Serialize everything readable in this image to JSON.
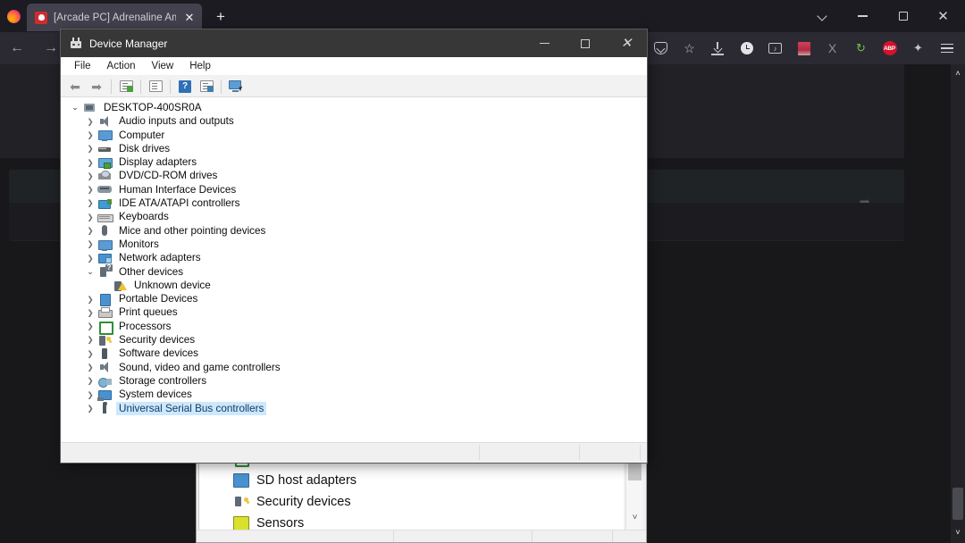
{
  "browser": {
    "name": "firefox",
    "logo_icon": "firefox-logo-icon",
    "tab": {
      "title": "[Arcade PC] Adrenaline Amusem",
      "favicon_icon": "site-favicon-icon",
      "close_icon": "✕"
    },
    "new_tab_label": "+",
    "list_all_tabs_icon": "chevron-down-icon",
    "window_controls": {
      "minimize": "—",
      "maximize": "❐",
      "close": "✕"
    },
    "nav": {
      "back_icon": "←",
      "forward_icon": "→"
    },
    "toolbar_icons": [
      {
        "name": "pocket-icon",
        "label": ""
      },
      {
        "name": "bookmark-star-icon",
        "label": "☆"
      },
      {
        "name": "downloads-icon",
        "label": ""
      },
      {
        "name": "history-clock-icon",
        "label": ""
      },
      {
        "name": "screenshot-icon",
        "label": "♪"
      },
      {
        "name": "extension-red-icon",
        "label": ""
      },
      {
        "name": "x-extension-icon",
        "label": "X"
      },
      {
        "name": "translate-sync-icon",
        "label": "↻"
      },
      {
        "name": "adblock-plus-icon",
        "label": "ABP"
      },
      {
        "name": "extensions-puzzle-icon",
        "label": "✦"
      },
      {
        "name": "app-menu-icon",
        "label": ""
      }
    ],
    "scrollbar": {
      "up_icon": "˄",
      "down_icon": "˅"
    }
  },
  "device_manager": {
    "title": "Device Manager",
    "title_icon": "device-manager-icon",
    "window_controls": {
      "minimize": "—",
      "maximize": "□",
      "close": "✕"
    },
    "menus": [
      {
        "label": "File"
      },
      {
        "label": "Action"
      },
      {
        "label": "View"
      },
      {
        "label": "Help"
      }
    ],
    "toolbar": [
      {
        "name": "back-button",
        "icon": "⬅"
      },
      {
        "name": "forward-button",
        "icon": "➡"
      },
      {
        "name": "properties-button",
        "icon": "properties-icon"
      },
      {
        "name": "update-driver-button",
        "icon": "update-driver-icon"
      },
      {
        "name": "help-button",
        "icon": "?"
      },
      {
        "name": "scan-hardware-button",
        "icon": "scan-icon"
      },
      {
        "name": "show-hidden-devices-button",
        "icon": "monitor-icon"
      }
    ],
    "tree": [
      {
        "label": "DESKTOP-400SR0A",
        "level": 0,
        "twist": "open",
        "icon": "ic-pc",
        "selected": false
      },
      {
        "label": "Audio inputs and outputs",
        "level": 1,
        "twist": "closed",
        "icon": "ic-speaker",
        "selected": false
      },
      {
        "label": "Computer",
        "level": 1,
        "twist": "closed",
        "icon": "ic-monitor2",
        "selected": false
      },
      {
        "label": "Disk drives",
        "level": 1,
        "twist": "closed",
        "icon": "ic-disk",
        "selected": false
      },
      {
        "label": "Display adapters",
        "level": 1,
        "twist": "closed",
        "icon": "ic-display",
        "selected": false
      },
      {
        "label": "DVD/CD-ROM drives",
        "level": 1,
        "twist": "closed",
        "icon": "ic-dvd",
        "selected": false
      },
      {
        "label": "Human Interface Devices",
        "level": 1,
        "twist": "closed",
        "icon": "ic-hid",
        "selected": false
      },
      {
        "label": "IDE ATA/ATAPI controllers",
        "level": 1,
        "twist": "closed",
        "icon": "ic-ide",
        "selected": false
      },
      {
        "label": "Keyboards",
        "level": 1,
        "twist": "closed",
        "icon": "ic-keyboard",
        "selected": false
      },
      {
        "label": "Mice and other pointing devices",
        "level": 1,
        "twist": "closed",
        "icon": "ic-mouse",
        "selected": false
      },
      {
        "label": "Monitors",
        "level": 1,
        "twist": "closed",
        "icon": "ic-monitor2",
        "selected": false
      },
      {
        "label": "Network adapters",
        "level": 1,
        "twist": "closed",
        "icon": "ic-network",
        "selected": false
      },
      {
        "label": "Other devices",
        "level": 1,
        "twist": "open",
        "icon": "ic-other",
        "selected": false
      },
      {
        "label": "Unknown device",
        "level": 2,
        "twist": "none",
        "icon": "ic-unknown",
        "selected": false
      },
      {
        "label": "Portable Devices",
        "level": 1,
        "twist": "closed",
        "icon": "ic-portable",
        "selected": false
      },
      {
        "label": "Print queues",
        "level": 1,
        "twist": "closed",
        "icon": "ic-printer",
        "selected": false
      },
      {
        "label": "Processors",
        "level": 1,
        "twist": "closed",
        "icon": "ic-proc",
        "selected": false
      },
      {
        "label": "Security devices",
        "level": 1,
        "twist": "closed",
        "icon": "ic-security",
        "selected": false
      },
      {
        "label": "Software devices",
        "level": 1,
        "twist": "closed",
        "icon": "ic-software",
        "selected": false
      },
      {
        "label": "Sound, video and game controllers",
        "level": 1,
        "twist": "closed",
        "icon": "ic-speaker",
        "selected": false
      },
      {
        "label": "Storage controllers",
        "level": 1,
        "twist": "closed",
        "icon": "ic-storage",
        "selected": false
      },
      {
        "label": "System devices",
        "level": 1,
        "twist": "closed",
        "icon": "ic-system",
        "selected": false
      },
      {
        "label": "Universal Serial Bus controllers",
        "level": 1,
        "twist": "closed",
        "icon": "ic-usb",
        "selected": true
      }
    ],
    "statusbar": ""
  },
  "device_manager_background": {
    "tree": [
      {
        "label": "Processors",
        "icon": "ic-proc"
      },
      {
        "label": "SD host adapters",
        "icon": "ic-sd"
      },
      {
        "label": "Security devices",
        "icon": "ic-security"
      },
      {
        "label": "Sensors",
        "icon": "ic-sensor"
      }
    ],
    "scrollbar_down_icon": "˅"
  },
  "colors": {
    "browser_chrome": "#1c1b22",
    "browser_navbar": "#2b2a33",
    "tab_active": "#42414d",
    "page_background": "#18181b",
    "dm_titlebar": "#373737",
    "dm_chrome": "#f0f0f0",
    "tree_background": "#ffffff",
    "selection": "#cce8ff",
    "selection_text": "#13395e",
    "adblock_red": "#d4132b"
  }
}
